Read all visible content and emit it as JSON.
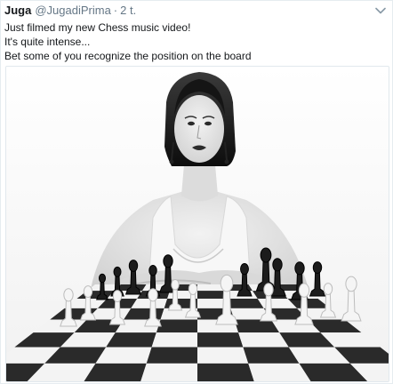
{
  "tweet": {
    "author_name": "Juga",
    "handle": "@JugadiPrima",
    "separator": "·",
    "time": "2 t.",
    "text_lines": [
      "Just filmed my new Chess music video!",
      "It's quite intense...",
      "Bet some of you recognize the position on the board"
    ]
  },
  "icons": {
    "more": "chevron-down-icon"
  }
}
